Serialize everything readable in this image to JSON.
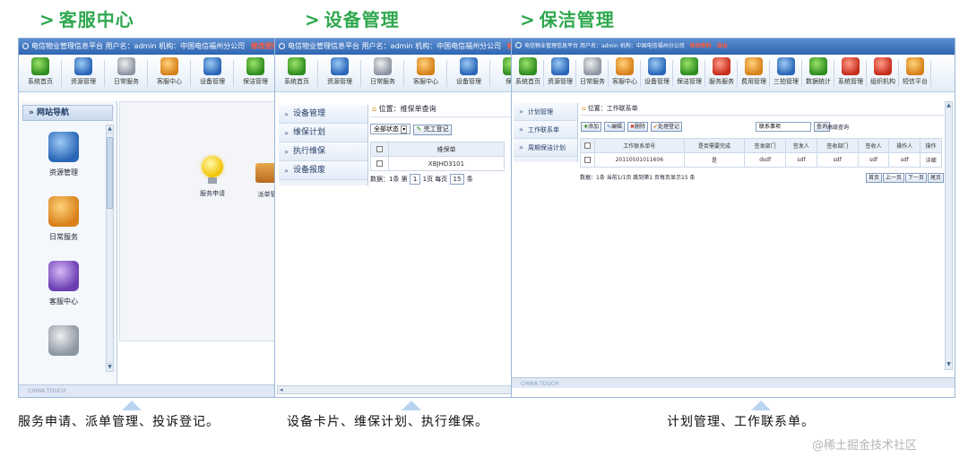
{
  "headings": {
    "left": "客服中心",
    "middle": "设备管理",
    "right": "保洁管理",
    "arrow": ">"
  },
  "title_bar": {
    "app_name": "电信物业管理信息平台",
    "user_label": "用户名：",
    "user_value": "admin",
    "org_label": "机构：",
    "org_value_left": "中国电信福州分公司",
    "org_value_mid": "中国电信福州分公司",
    "org_value_right": "中国电信福州分公司",
    "change_pwd": "修改密码",
    "logout_left": "退出",
    "logout_right": "退出"
  },
  "toolbar_left": [
    {
      "label": "系统首页",
      "icon": "home-icon",
      "color": "green"
    },
    {
      "label": "资源管理",
      "icon": "resource-icon",
      "color": "blue"
    },
    {
      "label": "日常服务",
      "icon": "daily-service-icon",
      "color": "gray"
    },
    {
      "label": "客服中心",
      "icon": "customer-service-icon",
      "color": "orange"
    },
    {
      "label": "设备管理",
      "icon": "equipment-icon",
      "color": "blue"
    },
    {
      "label": "保洁管理",
      "icon": "cleaning-icon",
      "color": "green"
    }
  ],
  "toolbar_middle": [
    {
      "label": "系统首页",
      "icon": "home-icon",
      "color": "green"
    },
    {
      "label": "资源管理",
      "icon": "resource-icon",
      "color": "blue"
    },
    {
      "label": "日常服务",
      "icon": "daily-service-icon",
      "color": "gray"
    },
    {
      "label": "客服中心",
      "icon": "customer-service-icon",
      "color": "orange"
    },
    {
      "label": "设备管理",
      "icon": "equipment-icon",
      "color": "blue"
    },
    {
      "label": "保洁",
      "icon": "cleaning-icon",
      "color": "green"
    }
  ],
  "toolbar_right": [
    {
      "label": "系统首页",
      "icon": "home-icon",
      "color": "green"
    },
    {
      "label": "资源管理",
      "icon": "resource-icon",
      "color": "blue"
    },
    {
      "label": "日常服务",
      "icon": "daily-service-icon",
      "color": "gray"
    },
    {
      "label": "客服中心",
      "icon": "customer-service-icon",
      "color": "orange"
    },
    {
      "label": "设备管理",
      "icon": "equipment-icon",
      "color": "blue"
    },
    {
      "label": "保洁管理",
      "icon": "cleaning-icon",
      "color": "green"
    },
    {
      "label": "服务服务",
      "icon": "service-icon",
      "color": "red"
    },
    {
      "label": "费用管理",
      "icon": "fee-icon",
      "color": "orange"
    },
    {
      "label": "三拍管理",
      "icon": "management-icon",
      "color": "blue"
    },
    {
      "label": "数据统计",
      "icon": "statistics-icon",
      "color": "green"
    },
    {
      "label": "系统管理",
      "icon": "system-icon",
      "color": "red"
    },
    {
      "label": "组织机构",
      "icon": "organization-icon",
      "color": "red"
    },
    {
      "label": "短信平台",
      "icon": "sms-icon",
      "color": "orange"
    }
  ],
  "left_window": {
    "nav_title": "网站导航",
    "nav_items": [
      {
        "label": "资源管理",
        "icon": "resource-large-icon",
        "color": "blue"
      },
      {
        "label": "日常服务",
        "icon": "daily-service-large-icon",
        "color": "orange"
      },
      {
        "label": "客服中心",
        "icon": "customer-service-large-icon",
        "color": "purple"
      },
      {
        "label": "",
        "icon": "equipment-large-icon",
        "color": "gray"
      }
    ],
    "content_items": [
      {
        "label": "服务申请",
        "icon": "lightbulb-icon"
      },
      {
        "label": "派单管",
        "icon": "truck-icon"
      }
    ],
    "status_text": "CHINA TOUCH"
  },
  "middle_window": {
    "nav_items": [
      "设备管理",
      "维保计划",
      "执行维保",
      "设备报废"
    ],
    "location_label": "位置：",
    "location_value": "维保单查询",
    "filter_select": "全部状态",
    "complete_button": "完工登记",
    "table_header": "维保单",
    "table_rows": [
      "XBJHD3101"
    ],
    "pager": {
      "prefix": "数据：1条 第",
      "page": "1",
      "mid": "1页 每页",
      "size": "15",
      "suffix": "条"
    }
  },
  "right_window": {
    "nav_items": [
      "计划管理",
      "工作联系单",
      "周期保洁计划"
    ],
    "location_label": "位置：",
    "location_value": "工作联系单",
    "actions": [
      "添加",
      "编辑",
      "删除",
      "处理登记"
    ],
    "search_value": "联系事项",
    "search_button": "查询",
    "advanced_search": "高级查询",
    "columns": [
      "",
      "工作联系单号",
      "是否需要完成",
      "签发部门",
      "签发人",
      "签收部门",
      "签收人",
      "操作人",
      "操作"
    ],
    "rows": [
      [
        "",
        "20110501011606",
        "是",
        "dsdf",
        "sdf",
        "sdf",
        "sdf",
        "sdf",
        "详细"
      ]
    ],
    "pager_text": "数据：1条 当前1/1页 跳到第1 页每页显示15 条",
    "pager_buttons": [
      "首页",
      "上一页",
      "下一页",
      "尾页"
    ],
    "status_text": "CHINA TOUCH"
  },
  "captions": {
    "left": "服务申请、派单管理、投诉登记。",
    "middle": "设备卡片、维保计划、执行维保。",
    "right": "计划管理、工作联系单。"
  },
  "watermark": "@稀土掘金技术社区"
}
